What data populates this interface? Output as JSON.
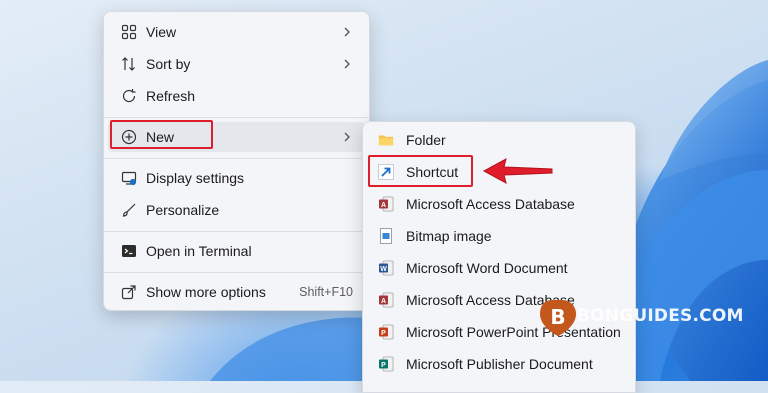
{
  "main_menu": {
    "items": [
      {
        "label": "View",
        "icon": "grid-icon",
        "submenu": true
      },
      {
        "label": "Sort by",
        "icon": "sort-icon",
        "submenu": true
      },
      {
        "label": "Refresh",
        "icon": "refresh-icon",
        "submenu": false
      },
      {
        "label": "New",
        "icon": "plus-circle-icon",
        "submenu": true
      },
      {
        "label": "Display settings",
        "icon": "display-icon",
        "submenu": false
      },
      {
        "label": "Personalize",
        "icon": "brush-icon",
        "submenu": false
      },
      {
        "label": "Open in Terminal",
        "icon": "terminal-icon",
        "submenu": false
      },
      {
        "label": "Show more options",
        "icon": "share-icon",
        "submenu": false,
        "shortcut": "Shift+F10"
      }
    ]
  },
  "sub_menu": {
    "items": [
      {
        "label": "Folder",
        "icon": "folder-icon"
      },
      {
        "label": "Shortcut",
        "icon": "shortcut-icon"
      },
      {
        "label": "Microsoft Access Database",
        "icon": "access-icon"
      },
      {
        "label": "Bitmap image",
        "icon": "bitmap-icon"
      },
      {
        "label": "Microsoft Word Document",
        "icon": "word-icon"
      },
      {
        "label": "Microsoft Access Database",
        "icon": "access-icon"
      },
      {
        "label": "Microsoft PowerPoint Presentation",
        "icon": "powerpoint-icon"
      },
      {
        "label": "Microsoft Publisher Document",
        "icon": "publisher-icon"
      }
    ]
  },
  "watermark": {
    "text": "BONGUIDES.COM",
    "letter": "B"
  },
  "colors": {
    "highlight_red": "#e01e2b",
    "access": "#a4373a",
    "word": "#2b579a",
    "powerpoint": "#c43e1c",
    "publisher": "#077568",
    "folder": "#f7c34a",
    "shortcut": "#1a6fc9"
  }
}
